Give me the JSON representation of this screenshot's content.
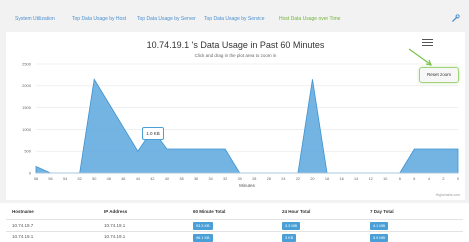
{
  "tabs": [
    {
      "label": "System Utilization",
      "active": false
    },
    {
      "label": "Top Data Usage by Host",
      "active": false
    },
    {
      "label": "Top Data Usage by Server",
      "active": false
    },
    {
      "label": "Top Data Usage by Service",
      "active": false
    },
    {
      "label": "Host Data Usage over Time",
      "active": true
    }
  ],
  "chart": {
    "title": "10.74.19.1 's Data Usage in Past 60 Minutes",
    "subtitle": "Click and drag in the plot area to zoom in",
    "reset_label": "Reset zoom",
    "tooltip": "1.0 KB",
    "credits": "Highcharts.com"
  },
  "chart_data": {
    "type": "area",
    "title": "10.74.19.1 's Data Usage in Past 60 Minutes",
    "xlabel": "Minutes",
    "ylabel": "",
    "ylim": [
      0,
      2500
    ],
    "yticks": [
      "0",
      "500",
      "1000",
      "1500",
      "2000",
      "2500"
    ],
    "x": [
      "58",
      "56",
      "54",
      "52",
      "50",
      "48",
      "46",
      "44",
      "42",
      "40",
      "38",
      "36",
      "34",
      "32",
      "30",
      "28",
      "26",
      "24",
      "22",
      "20",
      "18",
      "16",
      "14",
      "12",
      "10",
      "8",
      "6",
      "4",
      "2",
      "0"
    ],
    "series": [
      {
        "values": [
          150,
          0,
          0,
          0,
          2150,
          1600,
          1050,
          500,
          1000,
          550,
          550,
          550,
          550,
          550,
          0,
          0,
          0,
          0,
          0,
          2150,
          0,
          0,
          0,
          0,
          0,
          0,
          550,
          550,
          550,
          550
        ]
      }
    ],
    "color": "#5aa7de",
    "grid": true
  },
  "table": {
    "headers": [
      "Hostname",
      "IP Address",
      "60 Minute Total",
      "24 Hour Total",
      "7 Day Total"
    ],
    "rows": [
      {
        "hostname": "10.74.19.7",
        "ip": "10.74.19.1",
        "m60": "93.3 KB",
        "h24": "3.3 MB",
        "d7": "4.1 MB"
      },
      {
        "hostname": "10.74.19.1",
        "ip": "10.74.19.1",
        "m60": "96.1 KB",
        "h24": "3 KB",
        "d7": "5.9 MB"
      }
    ]
  }
}
